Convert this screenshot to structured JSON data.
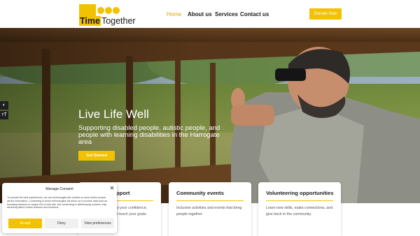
{
  "header": {
    "logo": {
      "word1": "Time",
      "word2": "Together"
    },
    "nav": [
      "Home",
      "About us",
      "Services",
      "Contact us"
    ],
    "donate": "Donate Now"
  },
  "hero": {
    "title": "Live Life Well",
    "subtitle": "Supporting disabled people, autistic people, and people with learning disabilities in the Harrogate area",
    "cta": "Get Started"
  },
  "accessibility": {
    "contrast_icon": "◐",
    "text_size_icon": "тT"
  },
  "cards": [
    {
      "title": "Personal support",
      "desc": "Helping you to grow your confidence, independence, and reach your goals."
    },
    {
      "title": "Community events",
      "desc": "Inclusive activities and events that bring people together."
    },
    {
      "title": "Volunteering opportunities",
      "desc": "Learn new skills, make connections, and give back to the community."
    }
  ],
  "consent": {
    "title": "Manage Consent",
    "close": "✕",
    "body": "To provide the best experiences, we use technologies like cookies to store and/or access device information. Consenting to these technologies will allow us to process data such as browsing behavior or unique IDs on this site. Not consenting or withdrawing consent, may adversely affect certain features and functions.",
    "accept": "Accept",
    "deny": "Deny",
    "view": "View preferences"
  },
  "colors": {
    "accent": "#f2c200",
    "dark": "#1a1a1a"
  }
}
